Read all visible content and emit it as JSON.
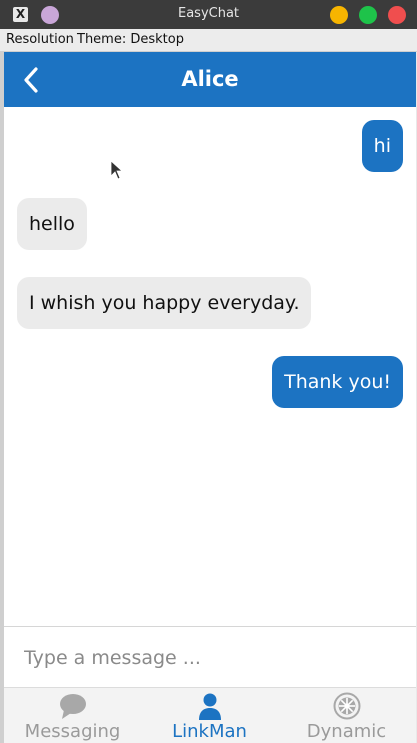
{
  "window": {
    "title": "EasyChat"
  },
  "menubar": {
    "items": [
      "Resolution",
      "Theme: Desktop"
    ]
  },
  "header": {
    "contact_name": "Alice"
  },
  "messages": [
    {
      "text": "hi",
      "direction": "outgoing"
    },
    {
      "text": "hello",
      "direction": "incoming"
    },
    {
      "text": "I whish you happy everyday.",
      "direction": "incoming"
    },
    {
      "text": "Thank you!",
      "direction": "outgoing"
    }
  ],
  "composer": {
    "placeholder": "Type a message ..."
  },
  "tabs": [
    {
      "label": "Messaging",
      "icon": "chat-bubble-icon",
      "active": false
    },
    {
      "label": "LinkMan",
      "icon": "person-icon",
      "active": true
    },
    {
      "label": "Dynamic",
      "icon": "aperture-icon",
      "active": false
    }
  ],
  "colors": {
    "accent": "#1c73c2",
    "incoming_bubble": "#ebebeb",
    "titlebar": "#3b3b3b"
  }
}
